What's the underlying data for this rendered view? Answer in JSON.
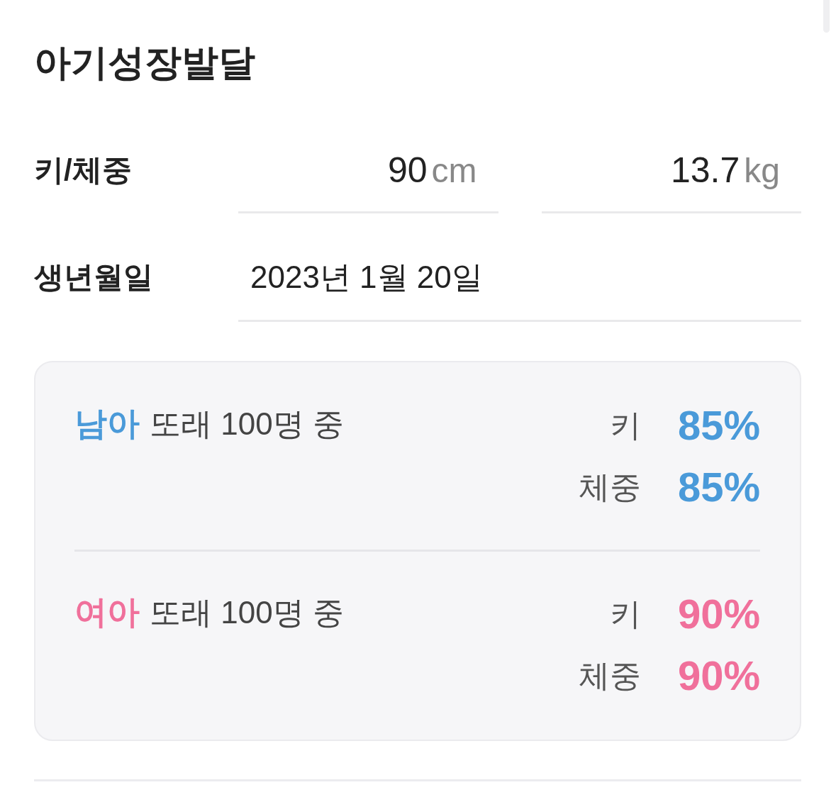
{
  "title": "아기성장발달",
  "measurements": {
    "label": "키/체중",
    "fields": [
      {
        "value": "90",
        "unit": "cm"
      },
      {
        "value": "13.7",
        "unit": "kg"
      }
    ]
  },
  "birth_date": {
    "label": "생년월일",
    "value": "2023년 1월 20일"
  },
  "percentile_card": {
    "groups": [
      {
        "group": "남아",
        "color": "#4a9ad9",
        "caption": "또래 100명 중",
        "metrics": [
          {
            "label": "키",
            "value": "85%"
          },
          {
            "label": "체중",
            "value": "85%"
          }
        ]
      },
      {
        "group": "여아",
        "color": "#f0709b",
        "caption": "또래 100명 중",
        "metrics": [
          {
            "label": "키",
            "value": "90%"
          },
          {
            "label": "체중",
            "value": "90%"
          }
        ]
      }
    ]
  }
}
